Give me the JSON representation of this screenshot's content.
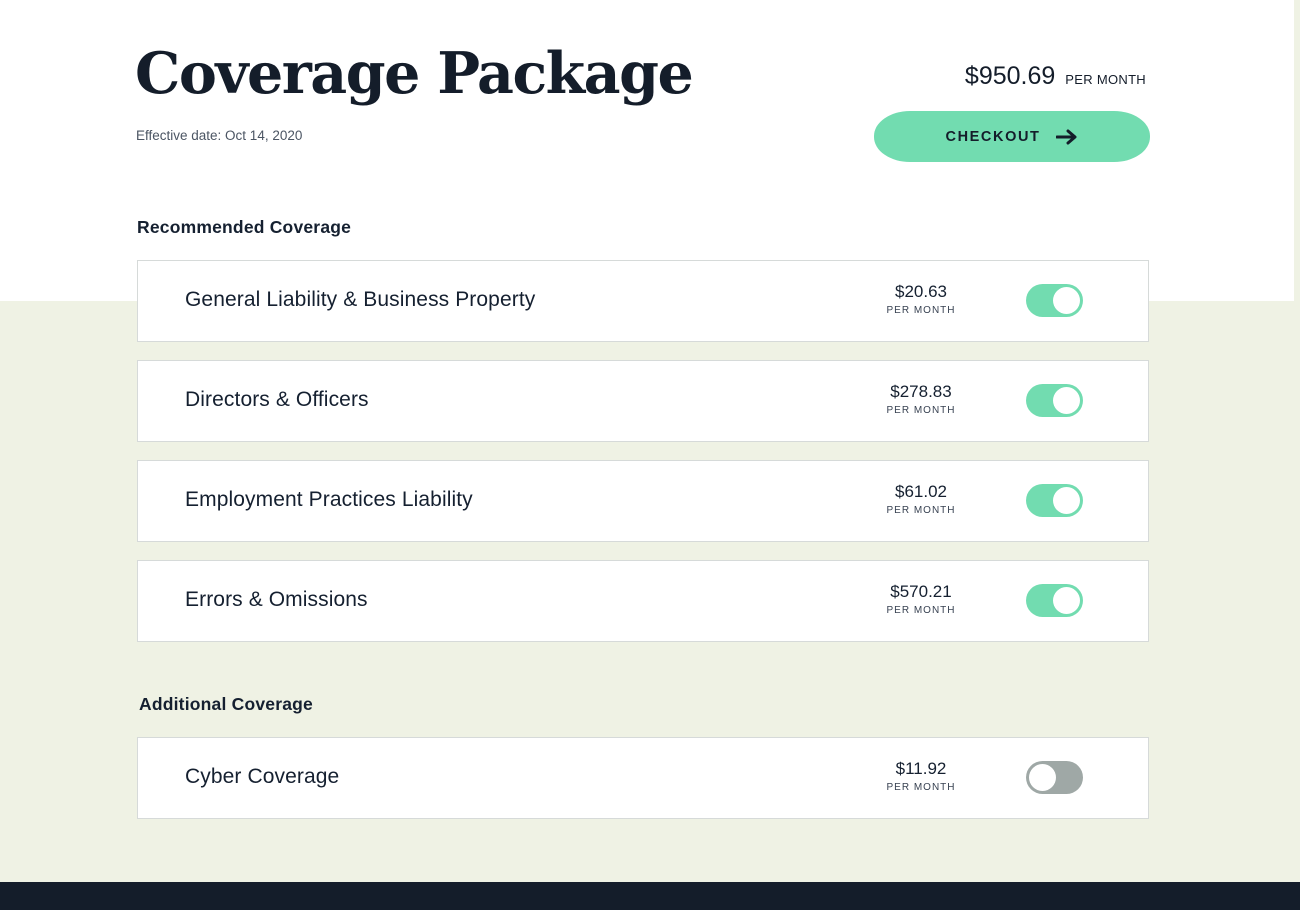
{
  "header": {
    "title": "Coverage Package",
    "effective_date": "Effective date: Oct 14, 2020",
    "total_amount": "$950.69",
    "total_unit": "PER MONTH",
    "checkout_label": "CHECKOUT",
    "checkout_icon": "arrow-right-icon"
  },
  "recommended": {
    "heading": "Recommended Coverage",
    "items": [
      {
        "name": "General Liability & Business Property",
        "price": "$20.63",
        "unit": "PER MONTH",
        "enabled": true
      },
      {
        "name": "Directors & Officers",
        "price": "$278.83",
        "unit": "PER MONTH",
        "enabled": true
      },
      {
        "name": "Employment Practices Liability",
        "price": "$61.02",
        "unit": "PER MONTH",
        "enabled": true
      },
      {
        "name": "Errors & Omissions",
        "price": "$570.21",
        "unit": "PER MONTH",
        "enabled": true
      }
    ]
  },
  "additional": {
    "heading": "Additional Coverage",
    "items": [
      {
        "name": "Cyber Coverage",
        "price": "$11.92",
        "unit": "PER MONTH",
        "enabled": false
      }
    ]
  },
  "colors": {
    "accent": "#72dcb0",
    "toggle_off": "#9fa8a6",
    "ink": "#141d2a",
    "tint_background": "#eff2e4"
  }
}
